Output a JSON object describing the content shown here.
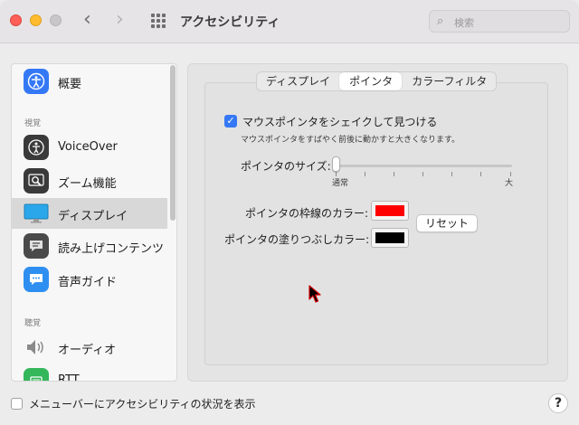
{
  "window": {
    "title": "アクセシビリティ",
    "search_placeholder": "検索"
  },
  "sidebar": {
    "items": [
      {
        "label": "概要",
        "icon": "accessibility-person-icon",
        "color": "#3478f6"
      },
      {
        "label": "VoiceOver",
        "icon": "voiceover-icon",
        "color": "#3a3a3a"
      },
      {
        "label": "ズーム機能",
        "icon": "zoom-magnifier-icon",
        "color": "#3a3a3a"
      },
      {
        "label": "ディスプレイ",
        "icon": "display-monitor-icon",
        "color": "#2aa7ea"
      },
      {
        "label": "読み上げコンテンツ",
        "icon": "speech-bubble-icon",
        "color": "#4a4a4a"
      },
      {
        "label": "音声ガイド",
        "icon": "descriptions-bubble-icon",
        "color": "#2f8ff0"
      },
      {
        "label": "オーディオ",
        "icon": "speaker-icon",
        "color": "#8a8a8a"
      },
      {
        "label": "RTT",
        "icon": "rtt-phone-icon",
        "color": "#34b65a"
      }
    ],
    "headers": {
      "vision": "視覚",
      "hearing": "聴覚"
    }
  },
  "tabs": [
    {
      "label": "ディスプレイ",
      "active": false
    },
    {
      "label": "ポインタ",
      "active": true
    },
    {
      "label": "カラーフィルタ",
      "active": false
    }
  ],
  "pointer": {
    "shake_label": "マウスポインタをシェイクして見つける",
    "shake_desc": "マウスポインタをすばやく前後に動かすと大きくなります。",
    "shake_checked": true,
    "size_label": "ポインタのサイズ:",
    "size_min": "通常",
    "size_max": "大",
    "size_value": 0,
    "outline_label": "ポインタの枠線のカラー:",
    "outline_color": "#ff0000",
    "fill_label": "ポインタの塗りつぶしカラー:",
    "fill_color": "#000000",
    "reset_label": "リセット"
  },
  "footer": {
    "menubar_label": "メニューバーにアクセシビリティの状況を表示",
    "help_label": "?"
  }
}
